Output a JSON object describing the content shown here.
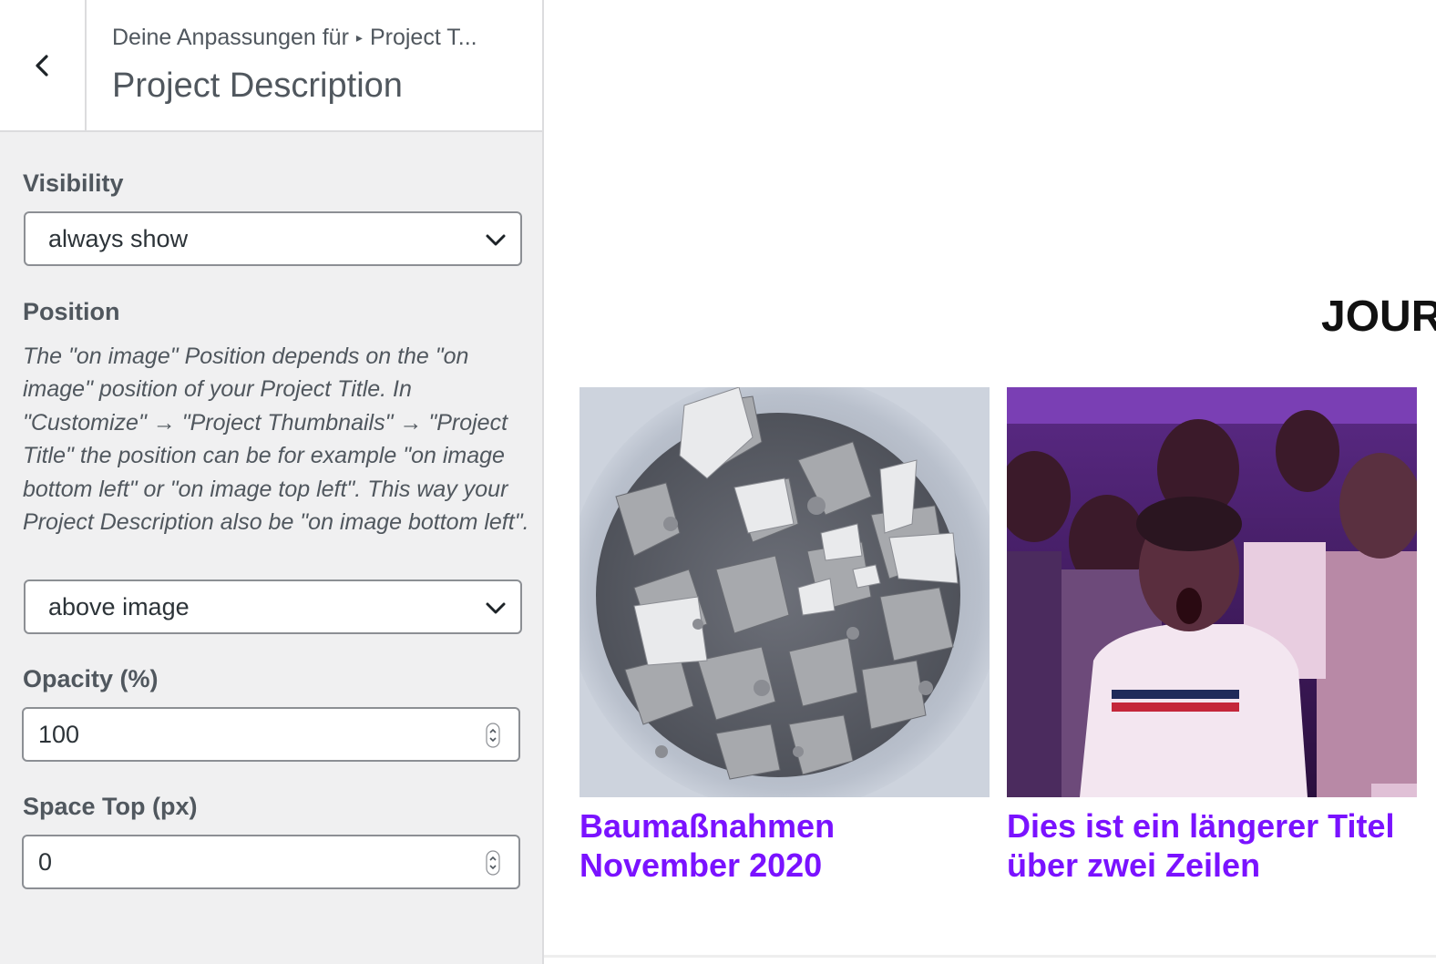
{
  "header": {
    "back_icon": "chevron-left-icon",
    "breadcrumb_prefix": "Deine Anpassungen für",
    "breadcrumb_separator": "▸",
    "breadcrumb_section": "Project T...",
    "title": "Project Description"
  },
  "controls": {
    "visibility": {
      "label": "Visibility",
      "selected": "always show"
    },
    "position": {
      "label": "Position",
      "description": "The \"on image\" Position depends on the \"on image\" position of your Project Title. In \"Customize\" → \"Project Thumbnails\" → \"Project Title\" the position can be for example \"on image bottom left\" or \"on image top left\". This way your Project Description also be \"on image bottom left\".",
      "selected": "above image"
    },
    "opacity": {
      "label": "Opacity (%)",
      "value": "100"
    },
    "space_top": {
      "label": "Space Top (px)",
      "value": "0"
    }
  },
  "preview": {
    "heading": "JOURNAL",
    "accent_color": "#7a12ff",
    "projects": [
      {
        "title": "Baumaßnahmen November 2020",
        "image": "rubble-bucket-photo"
      },
      {
        "title": "Dies ist ein längerer Titel über zwei Zeilen",
        "image": "worship-crowd-photo"
      }
    ]
  }
}
